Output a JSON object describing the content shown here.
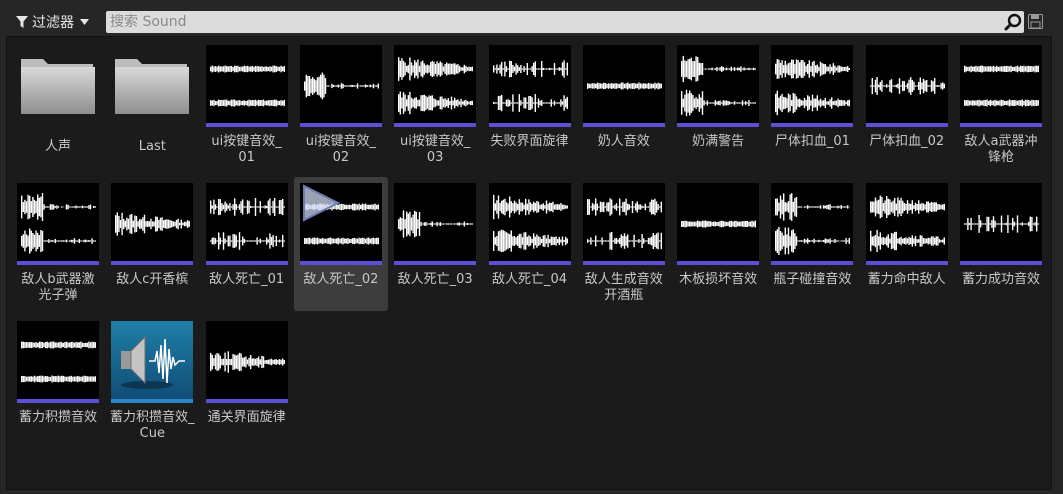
{
  "toolbar": {
    "filter_label": "过滤器",
    "search_placeholder": "搜索 Sound"
  },
  "colors": {
    "background": "#262626",
    "grid_background": "#1b1b1b",
    "sound_wave_accent": "#5c4fd6",
    "cue_accent": "#2a86c9",
    "selected_tile": "#3d3d3d"
  },
  "assets": [
    {
      "label": "人声",
      "kind": "folder"
    },
    {
      "label": "Last",
      "kind": "folder"
    },
    {
      "label": "ui按键音效_\n01",
      "kind": "sound-wave"
    },
    {
      "label": "ui按键音效_\n02",
      "kind": "sound-wave"
    },
    {
      "label": "ui按键音效_\n03",
      "kind": "sound-wave"
    },
    {
      "label": "失败界面旋律",
      "kind": "sound-wave"
    },
    {
      "label": "奶人音效",
      "kind": "sound-wave"
    },
    {
      "label": "奶满警告",
      "kind": "sound-wave"
    },
    {
      "label": "尸体扣血_01",
      "kind": "sound-wave"
    },
    {
      "label": "尸体扣血_02",
      "kind": "sound-wave"
    },
    {
      "label": "敌人a武器冲\n锋枪",
      "kind": "sound-wave"
    },
    {
      "label": "敌人b武器激\n光子弹",
      "kind": "sound-wave"
    },
    {
      "label": "敌人c开香槟",
      "kind": "sound-wave"
    },
    {
      "label": "敌人死亡_01",
      "kind": "sound-wave"
    },
    {
      "label": "敌人死亡_02",
      "kind": "sound-wave",
      "selected": true
    },
    {
      "label": "敌人死亡_03",
      "kind": "sound-wave"
    },
    {
      "label": "敌人死亡_04",
      "kind": "sound-wave"
    },
    {
      "label": "敌人生成音效\n开酒瓶",
      "kind": "sound-wave"
    },
    {
      "label": "木板损坏音效",
      "kind": "sound-wave"
    },
    {
      "label": "瓶子碰撞音效",
      "kind": "sound-wave"
    },
    {
      "label": "蓄力命中敌人",
      "kind": "sound-wave"
    },
    {
      "label": "蓄力成功音效",
      "kind": "sound-wave"
    },
    {
      "label": "蓄力积攒音效",
      "kind": "sound-wave"
    },
    {
      "label": "蓄力积攒音效_\nCue",
      "kind": "sound-cue"
    },
    {
      "label": "通关界面旋律",
      "kind": "sound-wave"
    }
  ]
}
